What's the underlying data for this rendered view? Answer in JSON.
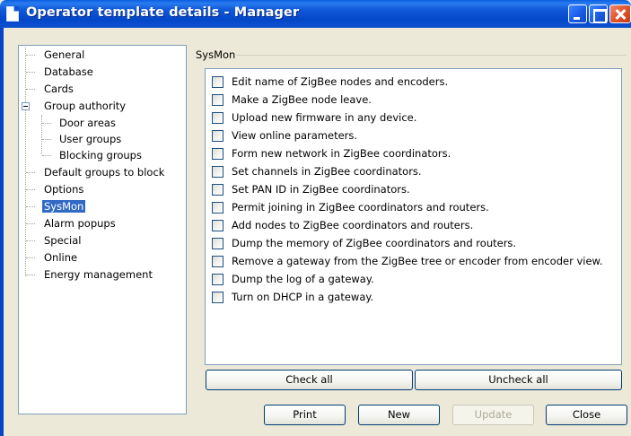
{
  "window": {
    "title": "Operator template details - Manager"
  },
  "tree": {
    "items": [
      {
        "label": "General"
      },
      {
        "label": "Database"
      },
      {
        "label": "Cards"
      },
      {
        "label": "Group authority"
      },
      {
        "label": "Door areas"
      },
      {
        "label": "User groups"
      },
      {
        "label": "Blocking groups"
      },
      {
        "label": "Default groups to block"
      },
      {
        "label": "Options"
      },
      {
        "label": "SysMon",
        "selected": true
      },
      {
        "label": "Alarm popups"
      },
      {
        "label": "Special"
      },
      {
        "label": "Online"
      },
      {
        "label": "Energy management"
      }
    ]
  },
  "panel": {
    "group_title": "SysMon",
    "permissions": [
      {
        "label": "Edit name of ZigBee nodes and encoders.",
        "checked": false
      },
      {
        "label": "Make a ZigBee node leave.",
        "checked": false
      },
      {
        "label": "Upload new firmware in any device.",
        "checked": false
      },
      {
        "label": "View online parameters.",
        "checked": false
      },
      {
        "label": "Form new network in ZigBee coordinators.",
        "checked": false
      },
      {
        "label": "Set channels in ZigBee coordinators.",
        "checked": false
      },
      {
        "label": "Set PAN ID in ZigBee coordinators.",
        "checked": false
      },
      {
        "label": "Permit joining in ZigBee coordinators and routers.",
        "checked": false
      },
      {
        "label": "Add nodes to ZigBee coordinators and routers.",
        "checked": false
      },
      {
        "label": "Dump the memory of ZigBee coordinators and routers.",
        "checked": false
      },
      {
        "label": "Remove a gateway from the ZigBee tree or encoder from encoder view.",
        "checked": false
      },
      {
        "label": "Dump the log of a gateway.",
        "checked": false
      },
      {
        "label": "Turn on DHCP in a gateway.",
        "checked": false
      }
    ],
    "check_all_label": "Check all",
    "uncheck_all_label": "Uncheck all"
  },
  "footer": {
    "print_label": "Print",
    "new_label": "New",
    "update_label": "Update",
    "update_enabled": false,
    "close_label": "Close"
  },
  "colors": {
    "titlebar": "#0a4fd0",
    "selection": "#316ac5",
    "dialog_bg": "#ece9d8"
  }
}
